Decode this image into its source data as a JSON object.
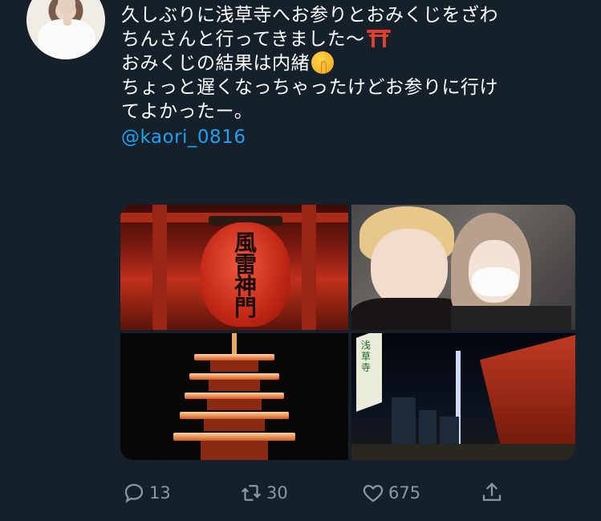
{
  "tweet": {
    "lines": [
      "久しぶりに浅草寺へお参りとおみくじをざわ",
      "ちんさんと行ってきました〜",
      "おみくじの結果は内緒",
      "ちょっと遅くなっちゃったけどお参りに行け",
      "てよかったー。"
    ],
    "mention": "@kaori_0816",
    "emoji": [
      "torii-icon",
      "shushing-face-icon"
    ]
  },
  "media": {
    "lantern_text": "風雷神門",
    "banner_text": "浅草寺"
  },
  "actions": {
    "reply_count": "13",
    "retweet_count": "30",
    "like_count": "675"
  },
  "colors": {
    "background": "#15202b",
    "text": "#ffffff",
    "link": "#1da1f2",
    "icon": "#8899a6"
  }
}
